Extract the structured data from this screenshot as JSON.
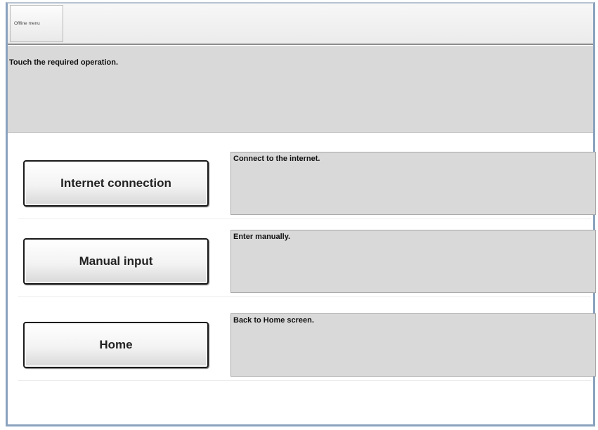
{
  "header": {
    "tab_label": "Offline menu"
  },
  "message": {
    "text": "Touch the required operation."
  },
  "operations": [
    {
      "label": "Internet connection",
      "description": "Connect to the internet."
    },
    {
      "label": "Manual input",
      "description": "Enter manually."
    },
    {
      "label": "Home",
      "description": "Back to Home screen."
    }
  ]
}
